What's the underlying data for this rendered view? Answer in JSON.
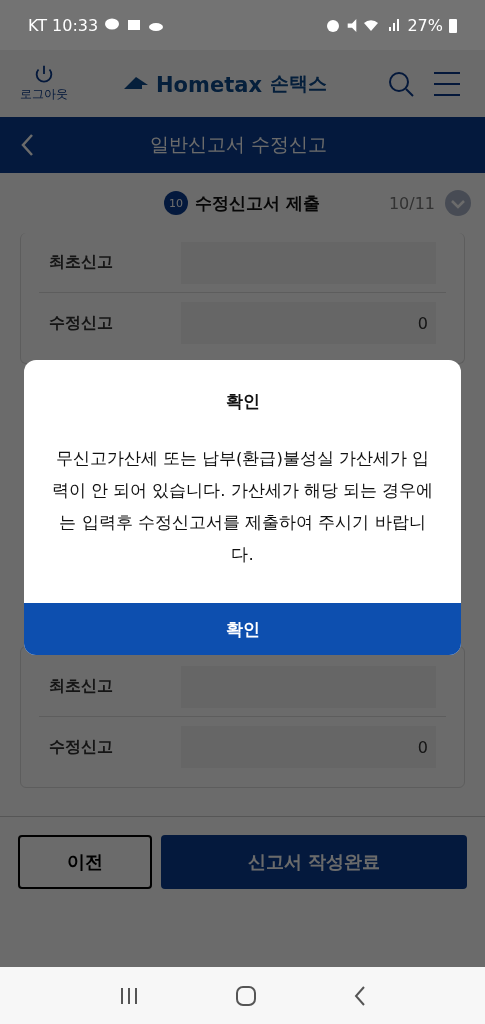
{
  "status_bar": {
    "carrier_time": "KT 10:33",
    "battery": "27%"
  },
  "header": {
    "logout_label": "로그아웃",
    "logo_text": "Hometax",
    "logo_korean": "손택스"
  },
  "title_bar": {
    "title": "일반신고서 수정신고"
  },
  "step": {
    "number": "10",
    "title": "수정신고서 제출",
    "progress": "10/11"
  },
  "cards": [
    {
      "rows": [
        {
          "label": "최초신고"
        },
        {
          "label": "수정신고",
          "value": "0"
        }
      ]
    },
    {
      "rows": [
        {
          "label": "최초신고"
        },
        {
          "label": "수정신고",
          "value": "0"
        }
      ]
    }
  ],
  "footer": {
    "prev_button": "이전",
    "submit_button": "신고서 작성완료"
  },
  "dialog": {
    "title": "확인",
    "message": "무신고가산세 또는 납부(환급)불성실 가산세가 입력이 안 되어 있습니다. 가산세가 해당 되는 경우에는 입력후 수정신고서를 제출하여 주시기 바랍니다.",
    "button": "확인"
  }
}
